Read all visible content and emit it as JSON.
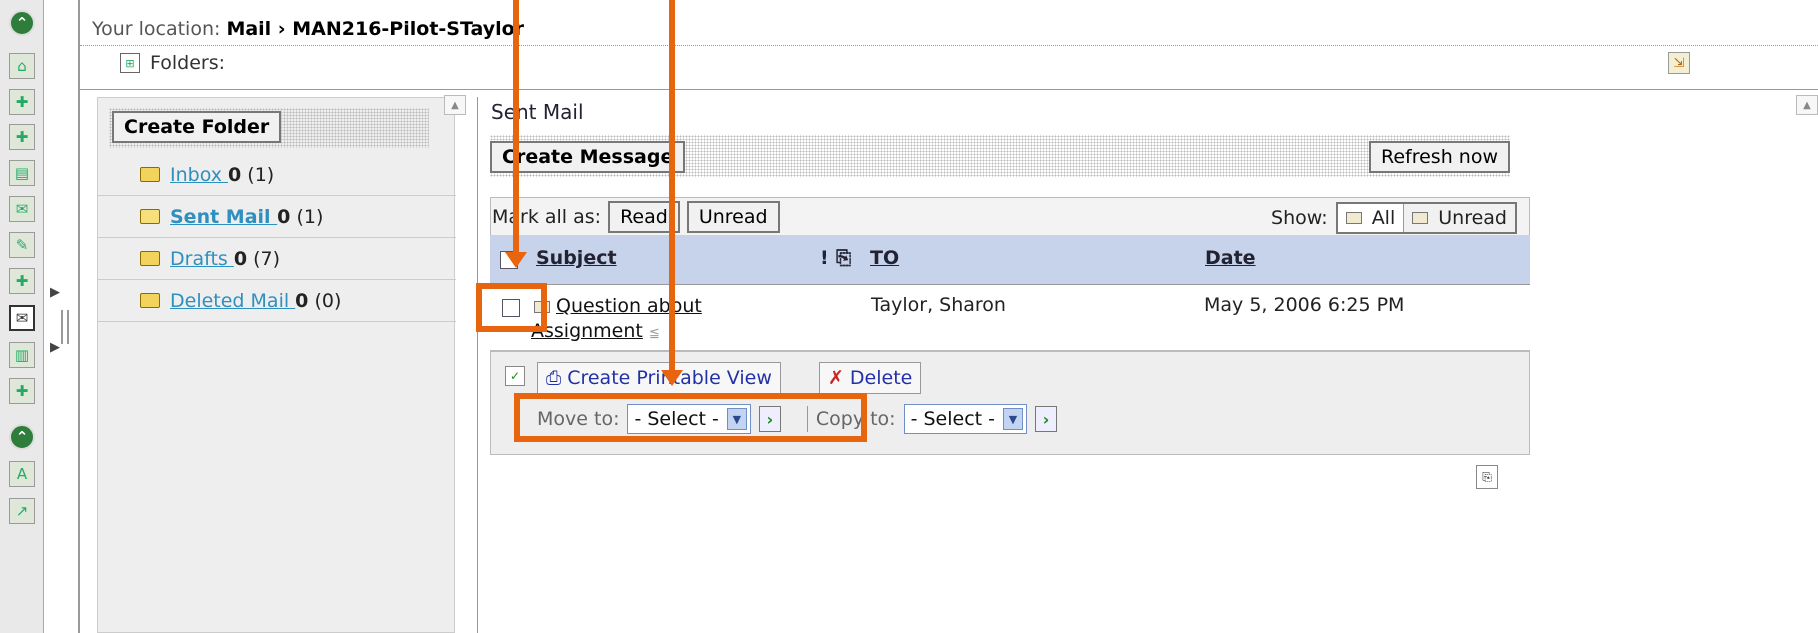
{
  "location": {
    "label": "Your location:",
    "path": "Mail › MAN216-Pilot-STaylor"
  },
  "folders_header": "Folders:",
  "left": {
    "create_folder": "Create Folder",
    "folders": [
      {
        "name": "Inbox ",
        "unread": "0",
        "total": " (1)"
      },
      {
        "name": "Sent Mail ",
        "unread": "0",
        "total": " (1)"
      },
      {
        "name": "Drafts ",
        "unread": "0",
        "total": " (7)"
      },
      {
        "name": "Deleted Mail ",
        "unread": "0",
        "total": " (0)"
      }
    ]
  },
  "right": {
    "title": "Sent Mail",
    "create_message": "Create Message",
    "refresh": "Refresh now",
    "mark_all_as": "Mark all as:",
    "read": "Read",
    "unread": "Unread",
    "show": "Show:",
    "show_all": "All",
    "show_unread": "Unread",
    "columns": {
      "subject": "Subject",
      "priority": "!",
      "to": "TO",
      "date": "Date"
    },
    "message": {
      "subject_line1": "Question about",
      "subject_line2": "Assignment",
      "to": "Taylor, Sharon",
      "date": "May 5, 2006 6:25 PM"
    },
    "printable": "Create Printable View",
    "delete": "Delete",
    "move_to": "Move to:",
    "copy_to": "Copy to:",
    "select_placeholder": "- Select -"
  },
  "icons": {
    "rail": [
      "collapse-icon",
      "home-icon",
      "site-icon",
      "user-add-icon",
      "calendar-icon",
      "discussion-icon",
      "pin-icon",
      "resource-icon",
      "mail-icon",
      "document-icon",
      "globe-icon",
      "collapse-icon",
      "assessment-icon",
      "chart-icon"
    ]
  },
  "colors": {
    "annotation": "#e8650f",
    "header_bg": "#c7d3ea",
    "link": "#2f8fbf"
  }
}
